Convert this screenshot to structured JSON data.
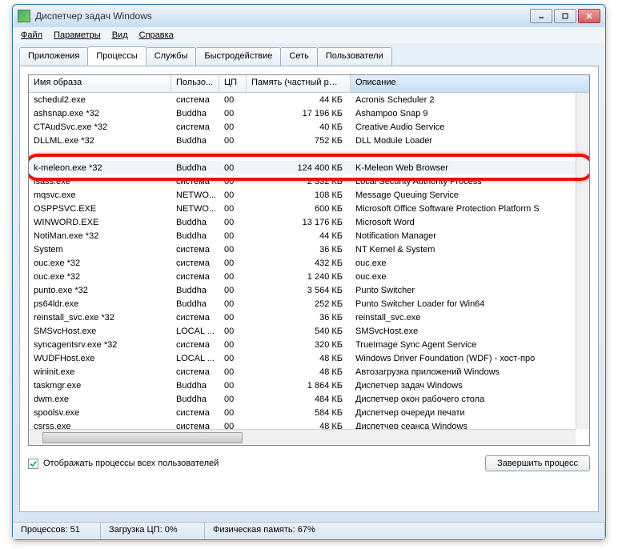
{
  "window": {
    "title": "Диспетчер задач Windows"
  },
  "menu": [
    "Файл",
    "Параметры",
    "Вид",
    "Справка"
  ],
  "tabs": [
    "Приложения",
    "Процессы",
    "Службы",
    "Быстродействие",
    "Сеть",
    "Пользователи"
  ],
  "active_tab": 1,
  "columns": [
    "Имя образа",
    "Пользо...",
    "ЦП",
    "Память (частный рабо...",
    "Описание"
  ],
  "rows": [
    {
      "name": "schedul2.exe",
      "user": "система",
      "cpu": "00",
      "mem": "44 КБ",
      "desc": "Acronis Scheduler 2"
    },
    {
      "name": "ashsnap.exe *32",
      "user": "Buddha",
      "cpu": "00",
      "mem": "17 196 КБ",
      "desc": "Ashampoo Snap 9"
    },
    {
      "name": "CTAudSvc.exe *32",
      "user": "система",
      "cpu": "00",
      "mem": "40 КБ",
      "desc": "Creative Audio Service"
    },
    {
      "name": "DLLML.exe *32",
      "user": "Buddha",
      "cpu": "00",
      "mem": "752 КБ",
      "desc": "DLL Module Loader"
    },
    {
      "name": "",
      "user": "",
      "cpu": "",
      "mem": "",
      "desc": ""
    },
    {
      "name": "k-meleon.exe *32",
      "user": "Buddha",
      "cpu": "00",
      "mem": "124 400 КБ",
      "desc": "K-Meleon Web Browser",
      "hl": true,
      "sel": true
    },
    {
      "name": "lsass.exe",
      "user": "система",
      "cpu": "00",
      "mem": "2 332 КБ",
      "desc": "Local Security Authority Process"
    },
    {
      "name": "mqsvc.exe",
      "user": "NETWO...",
      "cpu": "00",
      "mem": "108 КБ",
      "desc": "Message Queuing Service"
    },
    {
      "name": "OSPPSVC.EXE",
      "user": "NETWO...",
      "cpu": "00",
      "mem": "600 КБ",
      "desc": "Microsoft Office Software Protection Platform S"
    },
    {
      "name": "WINWORD.EXE",
      "user": "Buddha",
      "cpu": "00",
      "mem": "13 176 КБ",
      "desc": "Microsoft Word"
    },
    {
      "name": "NotiMan.exe *32",
      "user": "Buddha",
      "cpu": "00",
      "mem": "44 КБ",
      "desc": "Notification Manager"
    },
    {
      "name": "System",
      "user": "система",
      "cpu": "00",
      "mem": "36 КБ",
      "desc": "NT Kernel & System"
    },
    {
      "name": "ouc.exe *32",
      "user": "система",
      "cpu": "00",
      "mem": "432 КБ",
      "desc": "ouc.exe"
    },
    {
      "name": "ouc.exe *32",
      "user": "система",
      "cpu": "00",
      "mem": "1 240 КБ",
      "desc": "ouc.exe"
    },
    {
      "name": "punto.exe *32",
      "user": "Buddha",
      "cpu": "00",
      "mem": "3 564 КБ",
      "desc": "Punto Switcher"
    },
    {
      "name": "ps64ldr.exe",
      "user": "Buddha",
      "cpu": "00",
      "mem": "252 КБ",
      "desc": "Punto Switcher Loader for Win64"
    },
    {
      "name": "reinstall_svc.exe *32",
      "user": "система",
      "cpu": "00",
      "mem": "36 КБ",
      "desc": "reinstall_svc.exe"
    },
    {
      "name": "SMSvcHost.exe",
      "user": "LOCAL ...",
      "cpu": "00",
      "mem": "540 КБ",
      "desc": "SMSvcHost.exe"
    },
    {
      "name": "syncagentsrv.exe *32",
      "user": "система",
      "cpu": "00",
      "mem": "320 КБ",
      "desc": "TrueImage Sync Agent Service"
    },
    {
      "name": "WUDFHost.exe",
      "user": "LOCAL ...",
      "cpu": "00",
      "mem": "48 КБ",
      "desc": "Windows Driver Foundation (WDF) - хост-про"
    },
    {
      "name": "wininit.exe",
      "user": "система",
      "cpu": "00",
      "mem": "48 КБ",
      "desc": "Автозагрузка приложений Windows"
    },
    {
      "name": "taskmgr.exe",
      "user": "Buddha",
      "cpu": "00",
      "mem": "1 864 КБ",
      "desc": "Диспетчер задач Windows"
    },
    {
      "name": "dwm.exe",
      "user": "Buddha",
      "cpu": "00",
      "mem": "484 КБ",
      "desc": "Диспетчер окон рабочего стола"
    },
    {
      "name": "spoolsv.exe",
      "user": "система",
      "cpu": "00",
      "mem": "584 КБ",
      "desc": "Диспетчер очереди печати"
    },
    {
      "name": "csrss.exe",
      "user": "система",
      "cpu": "00",
      "mem": "48 КБ",
      "desc": "Диспетчер сеанса  Windows"
    }
  ],
  "checkbox_label": "Отображать процессы всех пользователей",
  "button_label": "Завершить процесс",
  "status": {
    "processes": "Процессов: 51",
    "cpu": "Загрузка ЦП: 0%",
    "mem": "Физическая память: 67%"
  }
}
